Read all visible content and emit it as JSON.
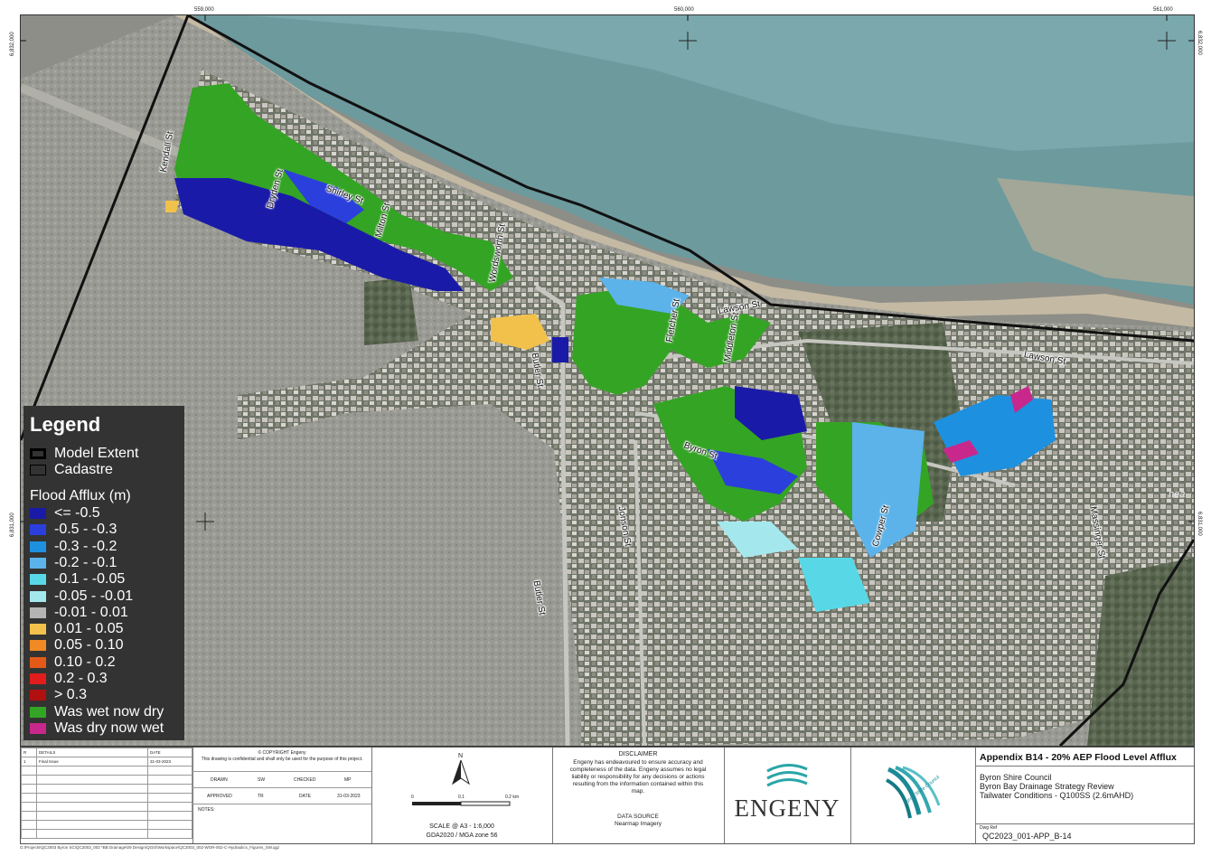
{
  "map": {
    "grid_top": [
      "559,000",
      "560,000",
      "561,000"
    ],
    "grid_left": [
      "6,832,000",
      "6,831,000"
    ],
    "grid_right": [
      "6,832,000",
      "6,831,000"
    ],
    "watermark": "nea"
  },
  "streets": [
    {
      "label": "Kendall St"
    },
    {
      "label": "Shirley St"
    },
    {
      "label": "Dryden St"
    },
    {
      "label": "Milton St"
    },
    {
      "label": "Wordsworth St"
    },
    {
      "label": "Butler St"
    },
    {
      "label": "Lawson St"
    },
    {
      "label": "Fletcher St"
    },
    {
      "label": "Middleton St"
    },
    {
      "label": "Lawson St"
    },
    {
      "label": "Byron St"
    },
    {
      "label": "Jonson St"
    },
    {
      "label": "Butler St"
    },
    {
      "label": "Cowper St"
    },
    {
      "label": "Massinger St"
    }
  ],
  "legend": {
    "title": "Legend",
    "model_extent": "Model Extent",
    "cadastre": "Cadastre",
    "flood_heading": "Flood Afflux (m)",
    "items": [
      {
        "label": "<= -0.5",
        "color": "#1a1aa8"
      },
      {
        "label": "-0.5 - -0.3",
        "color": "#2b3fdc"
      },
      {
        "label": "-0.3 - -0.2",
        "color": "#1e90e0"
      },
      {
        "label": "-0.2 - -0.1",
        "color": "#5cb3ea"
      },
      {
        "label": "-0.1 - -0.05",
        "color": "#58d8e6"
      },
      {
        "label": "-0.05 - -0.01",
        "color": "#a4e8ee"
      },
      {
        "label": "-0.01 - 0.01",
        "color": "#b4b4b4"
      },
      {
        "label": "0.01 - 0.05",
        "color": "#f2c14c"
      },
      {
        "label": "0.05 - 0.10",
        "color": "#f08a24"
      },
      {
        "label": "0.10 - 0.2",
        "color": "#e35a18"
      },
      {
        "label": "0.2 - 0.3",
        "color": "#e01c1c"
      },
      {
        "label": "> 0.3",
        "color": "#b01010"
      },
      {
        "label": "Was wet now dry",
        "color": "#34a424"
      },
      {
        "label": "Was dry now wet",
        "color": "#c8288c"
      }
    ]
  },
  "title_block": {
    "revision": {
      "headers": [
        "R",
        "DETAILS",
        "DATE"
      ],
      "rows": [
        [
          "1",
          "Final Issue",
          "31-03-2023"
        ]
      ]
    },
    "copyright": "© COPYRIGHT Engeny",
    "confidential": "This drawing is confidential and shall only be used for the purpose of this project.",
    "drawn_label": "DRAWN",
    "drawn_value": "SW",
    "checked_label": "CHECKED",
    "checked_value": "MP",
    "approved_label": "APPROVED",
    "approved_value": "TR",
    "date_label": "DATE",
    "date_value": "31-03-2023",
    "notes_label": "NOTES:",
    "north": "N",
    "scale_ticks": [
      "0",
      "0.1",
      "0.2 km"
    ],
    "scale_text": "SCALE @ A3 - 1:6,000",
    "crs": "GDA2020 / MGA zone 56",
    "disclaimer_title": "DISCLAIMER",
    "disclaimer_text": "Engeny has endeavoured to ensure accuracy and completeness of the data. Engeny assumes no legal liability or responsibility for any decisions or actions resulting from the information contained within this map.",
    "source_title": "DATA SOURCE",
    "source_text": "Nearmap Imagery",
    "engeny_logo_text": "ENGENY",
    "council_logo_text": "Byron Shire Council",
    "appendix_title": "Appendix B14 - 20% AEP Flood Level Afflux",
    "client": "Byron Shire Council",
    "project": "Byron Bay Drainage Strategy Review",
    "scenario": "Tailwater Conditions - Q100SS (2.6mAHD)",
    "dwg_label": "Dwg Ref",
    "dwg_no": "QC2023_001-APP_B-14"
  },
  "file_path": "G:\\Projects\\QC2003 Byron SC\\QC2003_002 *BB Drainage\\09 Design\\QGIS\\Workspace\\QC2003_002-WOR-002-C-Hydraulics_Figures_SW.qgz"
}
